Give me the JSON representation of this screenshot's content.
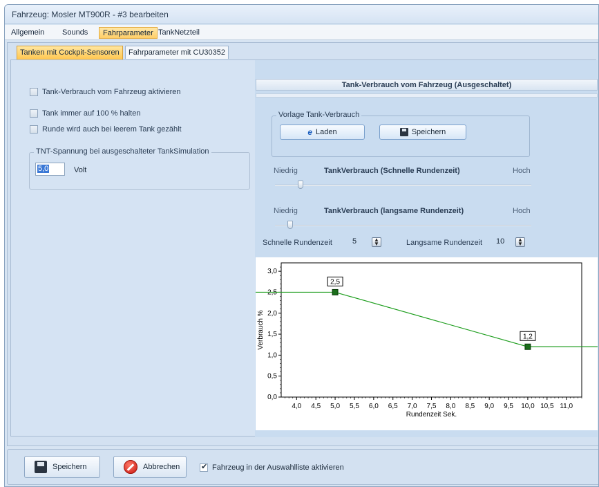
{
  "window": {
    "title": "Fahrzeug: Mosler MT900R - #3 bearbeiten"
  },
  "menu": [
    {
      "label": "Allgemein",
      "active": false
    },
    {
      "label": "Sounds",
      "active": false
    },
    {
      "label": "Fahrparameter",
      "active": true
    },
    {
      "label": "TankNetzteil",
      "active": false
    }
  ],
  "tabs": [
    {
      "label": "Tanken mit Cockpit-Sensoren",
      "active": true
    },
    {
      "label": "Fahrparameter mit CU30352",
      "active": false
    }
  ],
  "left": {
    "checkboxes": [
      {
        "label": "Tank-Verbrauch vom Fahrzeug aktivieren",
        "checked": false
      },
      {
        "label": "Tank immer auf 100 % halten",
        "checked": false
      },
      {
        "label": "Runde wird auch bei leerem Tank gezählt",
        "checked": false
      }
    ],
    "tnt_group": {
      "title": "TNT-Spannung bei ausgeschalteter TankSimulation",
      "value": "5,0",
      "unit": "Volt"
    }
  },
  "right": {
    "header": "Tank-Verbrauch vom Fahrzeug (Ausgeschaltet)",
    "vorlage": {
      "title": "Vorlage Tank-Verbrauch",
      "load_label": "Laden",
      "save_label": "Speichern"
    },
    "slider_fast": {
      "low": "Niedrig",
      "title": "TankVerbrauch (Schnelle Rundenzeit)",
      "high": "Hoch",
      "level": 0.1
    },
    "slider_slow": {
      "low": "Niedrig",
      "title": "TankVerbrauch (langsame Rundenzeit)",
      "high": "Hoch",
      "level": 0.06
    },
    "spin_fast": {
      "label": "Schnelle Rundenzeit",
      "value": "5"
    },
    "spin_slow": {
      "label": "Langsame Rundenzeit",
      "value": "10"
    }
  },
  "chart_data": {
    "type": "line",
    "xlabel": "Rundenzeit Sek.",
    "ylabel": "Verbrauch %",
    "xlim": [
      3.6,
      11.4
    ],
    "ylim": [
      0,
      3.2
    ],
    "x_ticks": [
      "4,0",
      "4,5",
      "5,0",
      "5,5",
      "6,0",
      "6,5",
      "7,0",
      "7,5",
      "8,0",
      "8,5",
      "9,0",
      "9,5",
      "10,0",
      "10,5",
      "11,0"
    ],
    "x_tick_values": [
      4.0,
      4.5,
      5.0,
      5.5,
      6.0,
      6.5,
      7.0,
      7.5,
      8.0,
      8.5,
      9.0,
      9.5,
      10.0,
      10.5,
      11.0
    ],
    "y_ticks": [
      "0,0",
      "0,5",
      "1,0",
      "1,5",
      "2,0",
      "2,5",
      "3,0"
    ],
    "y_tick_values": [
      0,
      0.5,
      1.0,
      1.5,
      2.0,
      2.5,
      3.0
    ],
    "series": [
      {
        "x": [
          3.6,
          5.0,
          10.0,
          11.4
        ],
        "y": [
          2.5,
          2.5,
          1.2,
          1.2
        ],
        "color": "#1e9e1e"
      }
    ],
    "points": [
      {
        "x": 5.0,
        "y": 2.5,
        "label": "2,5"
      },
      {
        "x": 10.0,
        "y": 1.2,
        "label": "1,2"
      }
    ],
    "grid": false,
    "legend": "none"
  },
  "bottom": {
    "save_label": "Speichern",
    "cancel_label": "Abbrechen",
    "check_label": "Fahrzeug in der Auswahlliste aktivieren",
    "checked": true
  }
}
